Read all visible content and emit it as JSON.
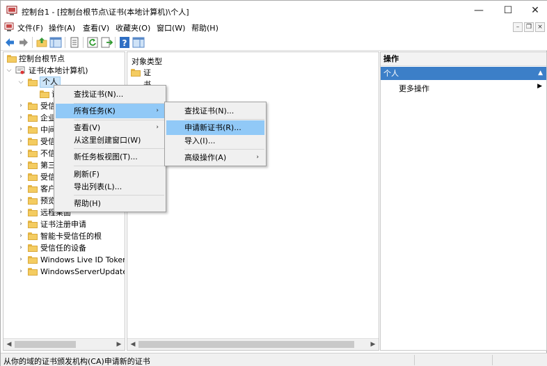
{
  "window": {
    "title": "控制台1 - [控制台根节点\\证书(本地计算机)\\个人]",
    "min_glyph": "—",
    "max_glyph": "☐",
    "close_glyph": "✕"
  },
  "menubar": {
    "items": [
      "文件(F)",
      "操作(A)",
      "查看(V)",
      "收藏夹(O)",
      "窗口(W)",
      "帮助(H)"
    ],
    "mdi_min": "–",
    "mdi_restore": "❐",
    "mdi_close": "×"
  },
  "toolbar": {
    "icons": [
      "back-icon",
      "forward-icon",
      "up-folder-icon",
      "show-hide-tree-icon",
      "properties-icon",
      "refresh-icon",
      "export-list-icon",
      "help-icon",
      "show-hide-action-pane-icon"
    ]
  },
  "tree": {
    "root": "控制台根节点",
    "cert_store": "证书(本地计算机)",
    "selected": "个人",
    "child_partial": "证",
    "items": [
      "受信",
      "企业",
      "中间",
      "受信",
      "不信",
      "第三",
      "受信",
      "客户",
      "预览",
      "远程桌面",
      "证书注册申请",
      "智能卡受信任的根",
      "受信任的设备",
      "Windows Live ID Token Issuer",
      "WindowsServerUpdateServices"
    ]
  },
  "list": {
    "column_header": "对象类型",
    "rows": [
      "证书"
    ]
  },
  "actions": {
    "title": "操作",
    "section": "个人",
    "more": "更多操作"
  },
  "status": {
    "text": "从你的域的证书颁发机构(CA)申请新的证书"
  },
  "context_menu": {
    "items": [
      "查找证书(N)...",
      "所有任务(K)",
      "查看(V)",
      "从这里创建窗口(W)",
      "新任务板视图(T)...",
      "刷新(F)",
      "导出列表(L)...",
      "帮助(H)"
    ]
  },
  "submenu": {
    "items": [
      "查找证书(N)...",
      "申请新证书(R)...",
      "导入(I)...",
      "高级操作(A)"
    ]
  },
  "colors": {
    "highlight": "#91c9f7",
    "section_header": "#3c7fc8",
    "folder": "#f4cc61"
  }
}
